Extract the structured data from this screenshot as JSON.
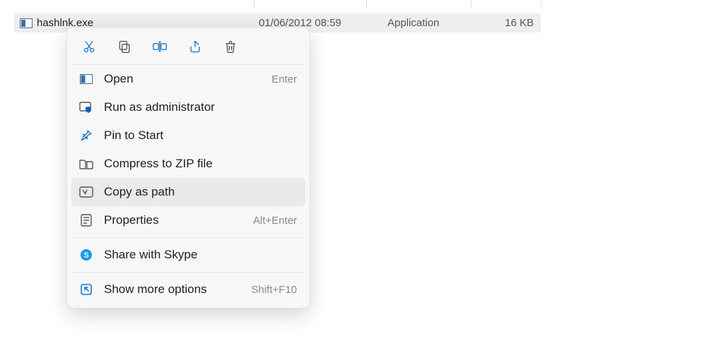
{
  "file": {
    "name": "hashlnk.exe",
    "date": "01/06/2012 08:59",
    "type": "Application",
    "size": "16 KB"
  },
  "toolbar": {
    "cut": "Cut",
    "copy": "Copy",
    "rename": "Rename",
    "share": "Share",
    "delete": "Delete"
  },
  "menu": {
    "open": {
      "label": "Open",
      "shortcut": "Enter"
    },
    "run_admin": {
      "label": "Run as administrator",
      "shortcut": ""
    },
    "pin_start": {
      "label": "Pin to Start",
      "shortcut": ""
    },
    "compress_zip": {
      "label": "Compress to ZIP file",
      "shortcut": ""
    },
    "copy_path": {
      "label": "Copy as path",
      "shortcut": ""
    },
    "properties": {
      "label": "Properties",
      "shortcut": "Alt+Enter"
    },
    "share_skype": {
      "label": "Share with Skype",
      "shortcut": ""
    },
    "more_options": {
      "label": "Show more options",
      "shortcut": "Shift+F10"
    }
  },
  "colors": {
    "accent": "#1976d2",
    "skype": "#0d9cf0"
  }
}
